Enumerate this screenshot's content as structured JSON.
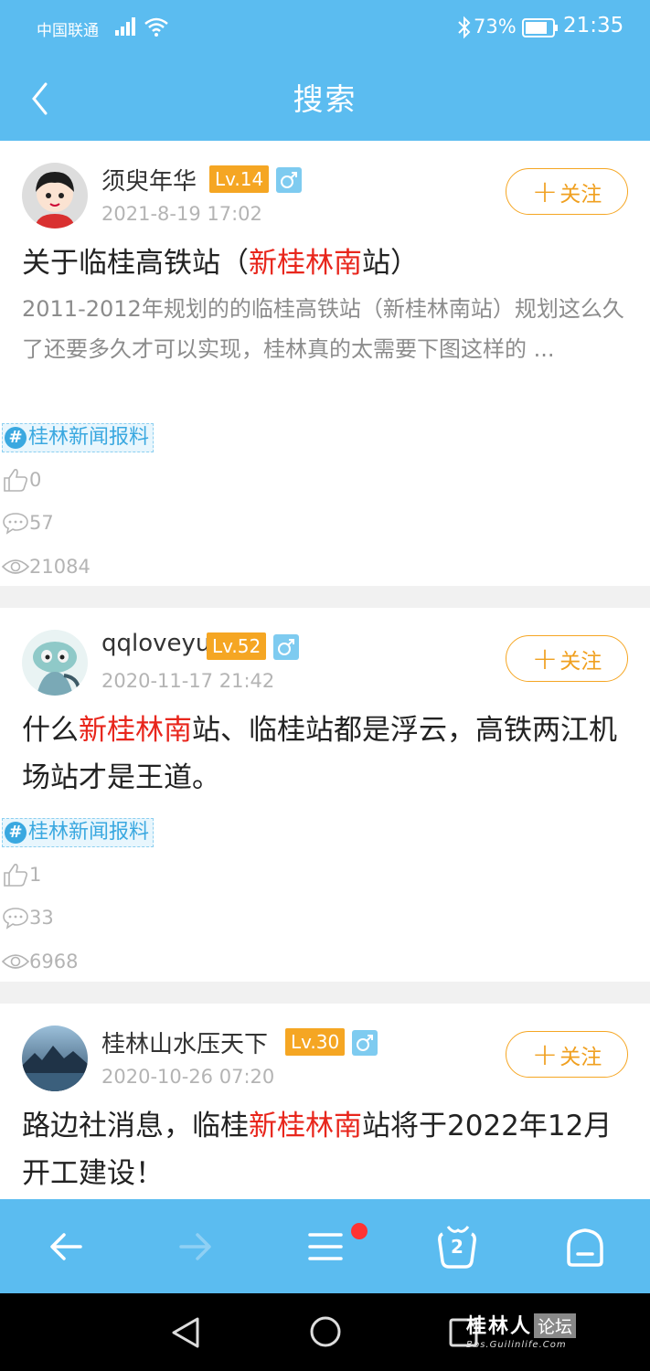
{
  "status_bar": {
    "carrier": "中国联通",
    "battery": "73%",
    "time": "21:35"
  },
  "header": {
    "title": "搜索"
  },
  "colors": {
    "accent": "#5bbcf0",
    "highlight": "#e8261c",
    "level_badge": "#f5a623"
  },
  "posts": [
    {
      "author": "须臾年华",
      "level": "Lv.14",
      "gender": "male",
      "time": "2021-8-19 17:02",
      "follow_label": "关注",
      "title": {
        "before": "关于临桂高铁站（",
        "highlight": "新桂林南",
        "after": "站）"
      },
      "excerpt": "2011-2012年规划的的临桂高铁站（新桂林南站）规划这么久了还要多久才可以实现，桂林真的太需要下图这样的 ...",
      "tag": "桂林新闻报料",
      "likes": "0",
      "comments": "57",
      "views": "21084"
    },
    {
      "author": "qqloveyu",
      "level": "Lv.52",
      "gender": "male",
      "time": "2020-11-17 21:42",
      "follow_label": "关注",
      "title": {
        "before": "什么",
        "highlight": "新桂林南",
        "after": "站、临桂站都是浮云，高铁两江机场站才是王道。"
      },
      "tag": "桂林新闻报料",
      "likes": "1",
      "comments": "33",
      "views": "6968"
    },
    {
      "author": "桂林山水压天下",
      "level": "Lv.30",
      "gender": "male",
      "time": "2020-10-26 07:20",
      "follow_label": "关注",
      "title": {
        "before": "路边社消息，临桂",
        "highlight": "新桂林南",
        "after": "站将于2022年12月开工建设！"
      }
    }
  ],
  "toolbar": {
    "tabs_count": "2"
  },
  "watermark": {
    "main": "桂林人",
    "box": "论坛",
    "sub": "Bbs.Guilinlife.Com"
  }
}
